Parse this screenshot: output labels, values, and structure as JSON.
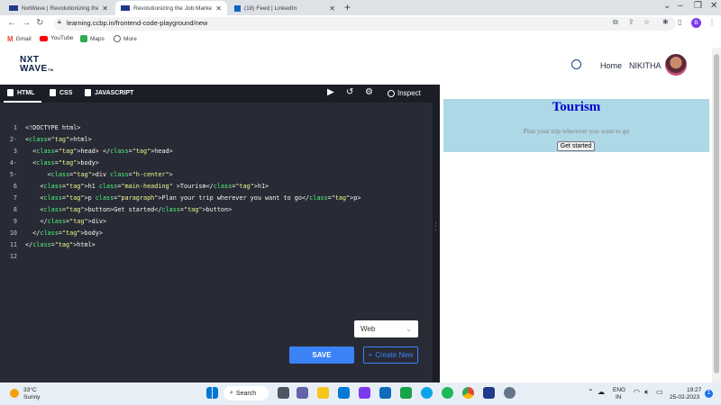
{
  "browser": {
    "tabs": [
      {
        "label": "NxtWave | Revolutionizing the Jo"
      },
      {
        "label": "Revolutionizing the Job Market |"
      },
      {
        "label": "(18) Feed | LinkedIn"
      }
    ],
    "url": "learning.ccbp.in/frontend-code-playground/new",
    "bookmarks": [
      "Gmail",
      "YouTube",
      "Maps",
      "More"
    ],
    "profile_initial": "B"
  },
  "header": {
    "logo_line1": "NXT",
    "logo_line2": "WAVE",
    "logo_suffix": "TM",
    "home_label": "Home",
    "user_name": "NIKITHA"
  },
  "editor": {
    "tabs": [
      "HTML",
      "CSS",
      "JAVASCRIPT"
    ],
    "inspect_label": "Inspect",
    "line_numbers": [
      "1",
      "2",
      "3",
      "4",
      "5",
      "6",
      "7",
      "8",
      "9",
      "10",
      "11",
      "12"
    ],
    "line_markers": [
      "",
      "-",
      "",
      "-",
      "-",
      "",
      "",
      "",
      "",
      "",
      "",
      ""
    ],
    "lines": [
      {
        "text": "<!DOCTYPE html>"
      },
      {
        "text": "<html>"
      },
      {
        "text": "  <head> </head>"
      },
      {
        "text": "  <body>"
      },
      {
        "text": "      <div class=\"h-center\">"
      },
      {
        "text": "    <h1 class=\"main-heading\" >Tourism</h1>"
      },
      {
        "text": "    <p class=\"paragraph\">Plan your trip wherever you want to go</p>"
      },
      {
        "text": "    <button>Get started</button>"
      },
      {
        "text": "    </div>"
      },
      {
        "text": "  </body>"
      },
      {
        "text": "</html>"
      },
      {
        "text": ""
      }
    ],
    "mode_select": "Web",
    "save_label": "SAVE",
    "create_label": "Create New"
  },
  "preview": {
    "heading": "Tourism",
    "paragraph": "Plan your trip wherever you want to go",
    "button": "Get started",
    "bg_color": "#add8e6",
    "heading_color": "#0000cd"
  },
  "taskbar": {
    "temp": "33°C",
    "weather": "Sunny",
    "search_label": "Search",
    "lang_top": "ENG",
    "lang_bottom": "IN",
    "time": "19:27",
    "date": "25-02-2023",
    "notif_count": "1"
  }
}
